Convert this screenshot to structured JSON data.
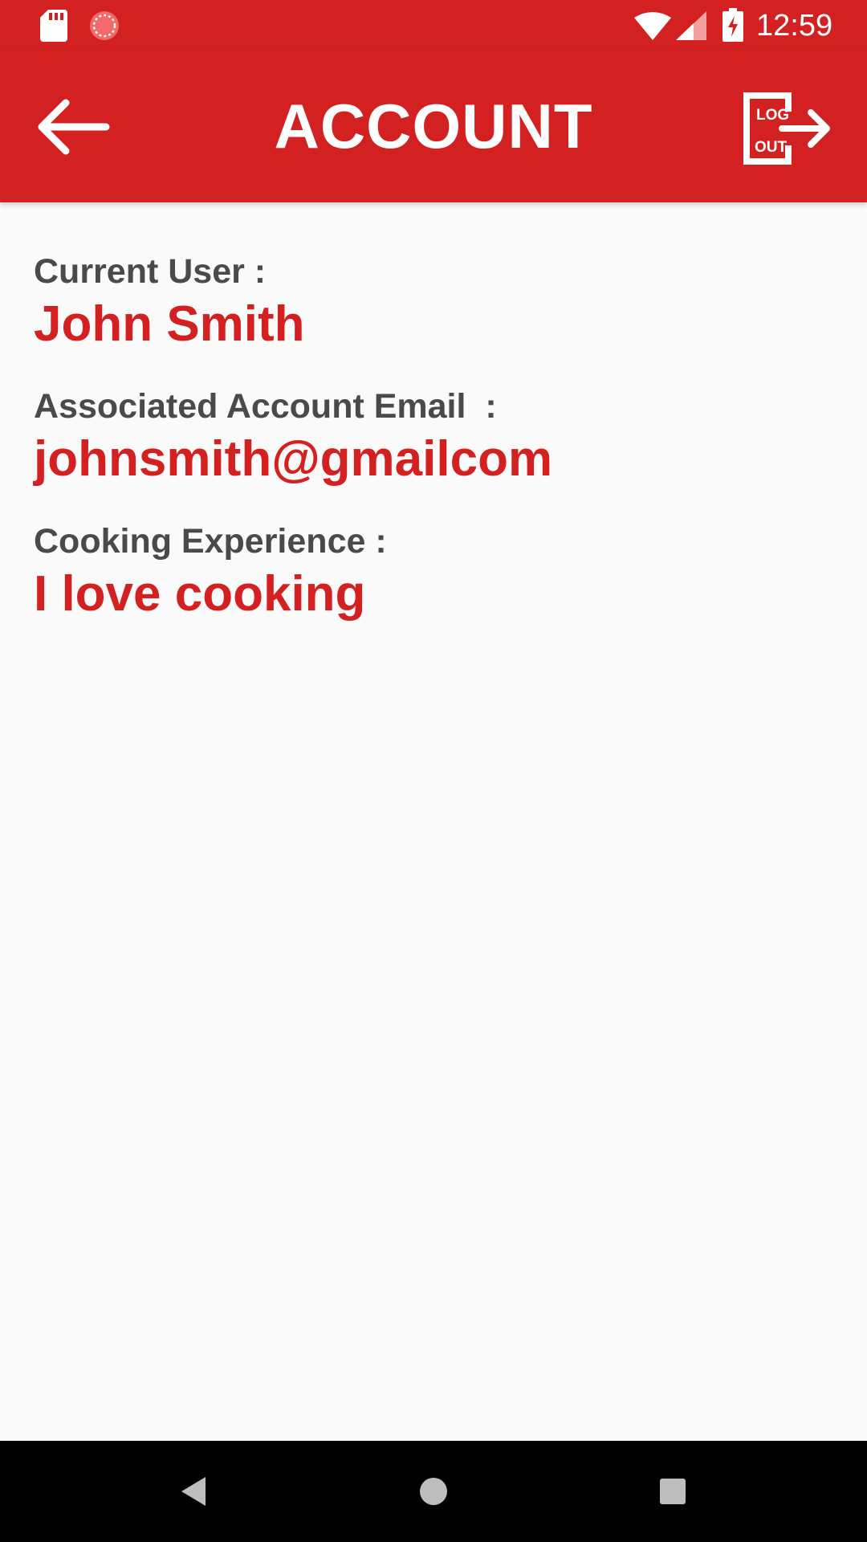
{
  "status_bar": {
    "time": "12:59",
    "icons": [
      "sd-card-icon",
      "recording-icon",
      "wifi-icon",
      "cell-signal-icon",
      "battery-charging-icon"
    ]
  },
  "app_bar": {
    "title": "ACCOUNT",
    "back_icon": "arrow-left-icon",
    "logout": {
      "icon": "logout-icon",
      "line1": "LOG",
      "line2": "OUT"
    }
  },
  "account": {
    "user_label": "Current User :",
    "user_value": "John Smith",
    "email_label": "Associated Account Email  :",
    "email_value": "johnsmith@gmailcom",
    "experience_label": "Cooking Experience :",
    "experience_value": "I love cooking"
  },
  "nav_bar": {
    "icons": [
      "nav-back-icon",
      "nav-home-icon",
      "nav-recents-icon"
    ]
  },
  "colors": {
    "primary": "#D32020",
    "label_text": "#4A4A4A",
    "background": "#FAFAFA",
    "nav_background": "#000000"
  }
}
